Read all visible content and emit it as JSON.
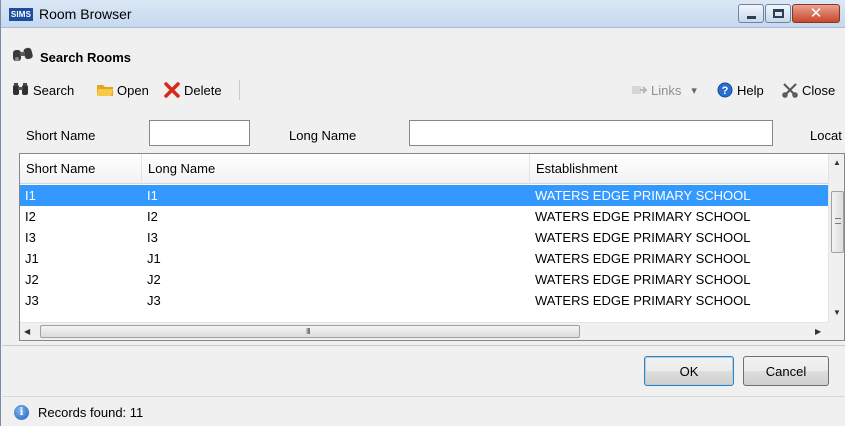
{
  "window": {
    "app_badge": "SIMS",
    "title": "Room Browser",
    "close_glyph": "✕"
  },
  "header": {
    "title": "Search Rooms",
    "icon": "binoculars-icon"
  },
  "toolbar": {
    "search_label": "Search",
    "open_label": "Open",
    "delete_label": "Delete",
    "links_label": "Links",
    "links_arrow": "▾",
    "help_label": "Help",
    "close_label": "Close"
  },
  "filters": {
    "short_name_label": "Short Name",
    "long_name_label": "Long Name",
    "location_label": "Locat",
    "short_name_value": "",
    "long_name_value": ""
  },
  "grid": {
    "columns": [
      "Short Name",
      "Long Name",
      "Establishment"
    ],
    "rows": [
      {
        "short": "I1",
        "long": "I1",
        "establishment": "WATERS EDGE PRIMARY SCHOOL",
        "selected": true
      },
      {
        "short": "I2",
        "long": "I2",
        "establishment": "WATERS EDGE PRIMARY SCHOOL",
        "selected": false
      },
      {
        "short": "I3",
        "long": "I3",
        "establishment": "WATERS EDGE PRIMARY SCHOOL",
        "selected": false
      },
      {
        "short": "J1",
        "long": "J1",
        "establishment": "WATERS EDGE PRIMARY SCHOOL",
        "selected": false
      },
      {
        "short": "J2",
        "long": "J2",
        "establishment": "WATERS EDGE PRIMARY SCHOOL",
        "selected": false
      },
      {
        "short": "J3",
        "long": "J3",
        "establishment": "WATERS EDGE PRIMARY SCHOOL",
        "selected": false
      }
    ],
    "hscroll_grip": "III"
  },
  "buttons": {
    "ok_label": "OK",
    "cancel_label": "Cancel"
  },
  "status": {
    "text": "Records found: 11",
    "info_glyph": "i"
  },
  "colors": {
    "selection": "#3399ff",
    "title_bar": "#c6d9ef",
    "close_button": "#c7472c"
  }
}
